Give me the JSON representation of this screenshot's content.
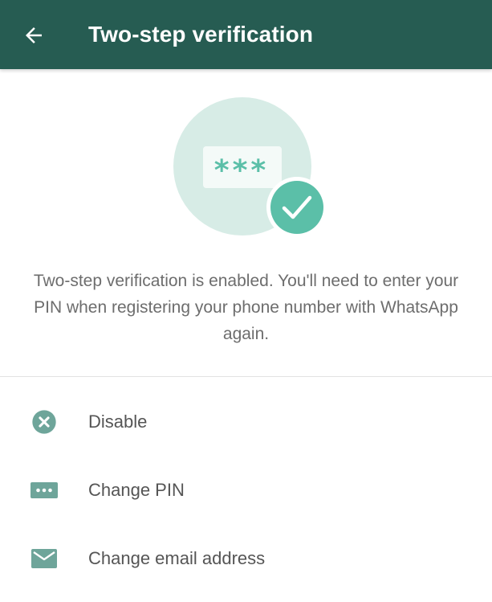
{
  "toolbar": {
    "title": "Two-step verification",
    "back_icon": "arrow-left-icon",
    "background": "#265c52"
  },
  "illustration": {
    "pin_mask": "***",
    "accent": "#5bbfa8",
    "circle_bg": "#d7ece6",
    "icons": [
      "password-field-icon",
      "checkmark-badge-icon"
    ]
  },
  "description": "Two-step verification is enabled. You'll need to enter your PIN when registering your phone number with WhatsApp again.",
  "menu": {
    "icon_color": "#6ea59a",
    "items": [
      {
        "label": "Disable",
        "icon": "close-circle-icon"
      },
      {
        "label": "Change PIN",
        "icon": "dots-icon"
      },
      {
        "label": "Change email address",
        "icon": "mail-icon"
      }
    ]
  }
}
